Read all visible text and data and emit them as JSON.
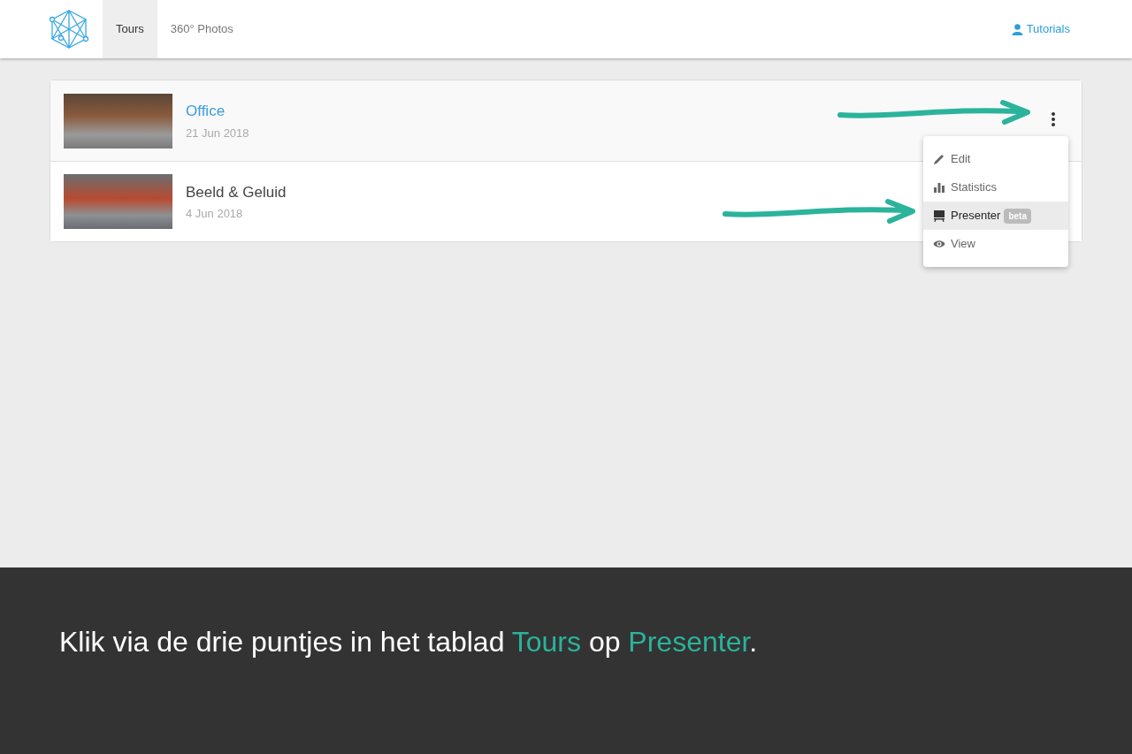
{
  "nav": {
    "tabs": [
      {
        "label": "Tours",
        "selected": true
      },
      {
        "label": "360° Photos",
        "selected": false
      }
    ],
    "tutorials": "Tutorials"
  },
  "tours": [
    {
      "title": "Office",
      "date": "21 Jun 2018",
      "selected": true
    },
    {
      "title": "Beeld & Geluid",
      "date": "4 Jun 2018",
      "selected": false
    }
  ],
  "menu": {
    "items": [
      {
        "kind": "edit",
        "label": "Edit",
        "selected": false
      },
      {
        "kind": "stats",
        "label": "Statistics",
        "selected": false
      },
      {
        "kind": "presenter",
        "label": "Presenter",
        "badge": "beta",
        "selected": true
      },
      {
        "kind": "view",
        "label": "View",
        "selected": false
      }
    ]
  },
  "caption": [
    {
      "text": "Klik via de drie puntjes in het tablad ",
      "highlight": false
    },
    {
      "text": "Tours",
      "highlight": true
    },
    {
      "text": " op ",
      "highlight": false
    },
    {
      "text": "Presenter",
      "highlight": true
    },
    {
      "text": ".",
      "highlight": false
    }
  ]
}
